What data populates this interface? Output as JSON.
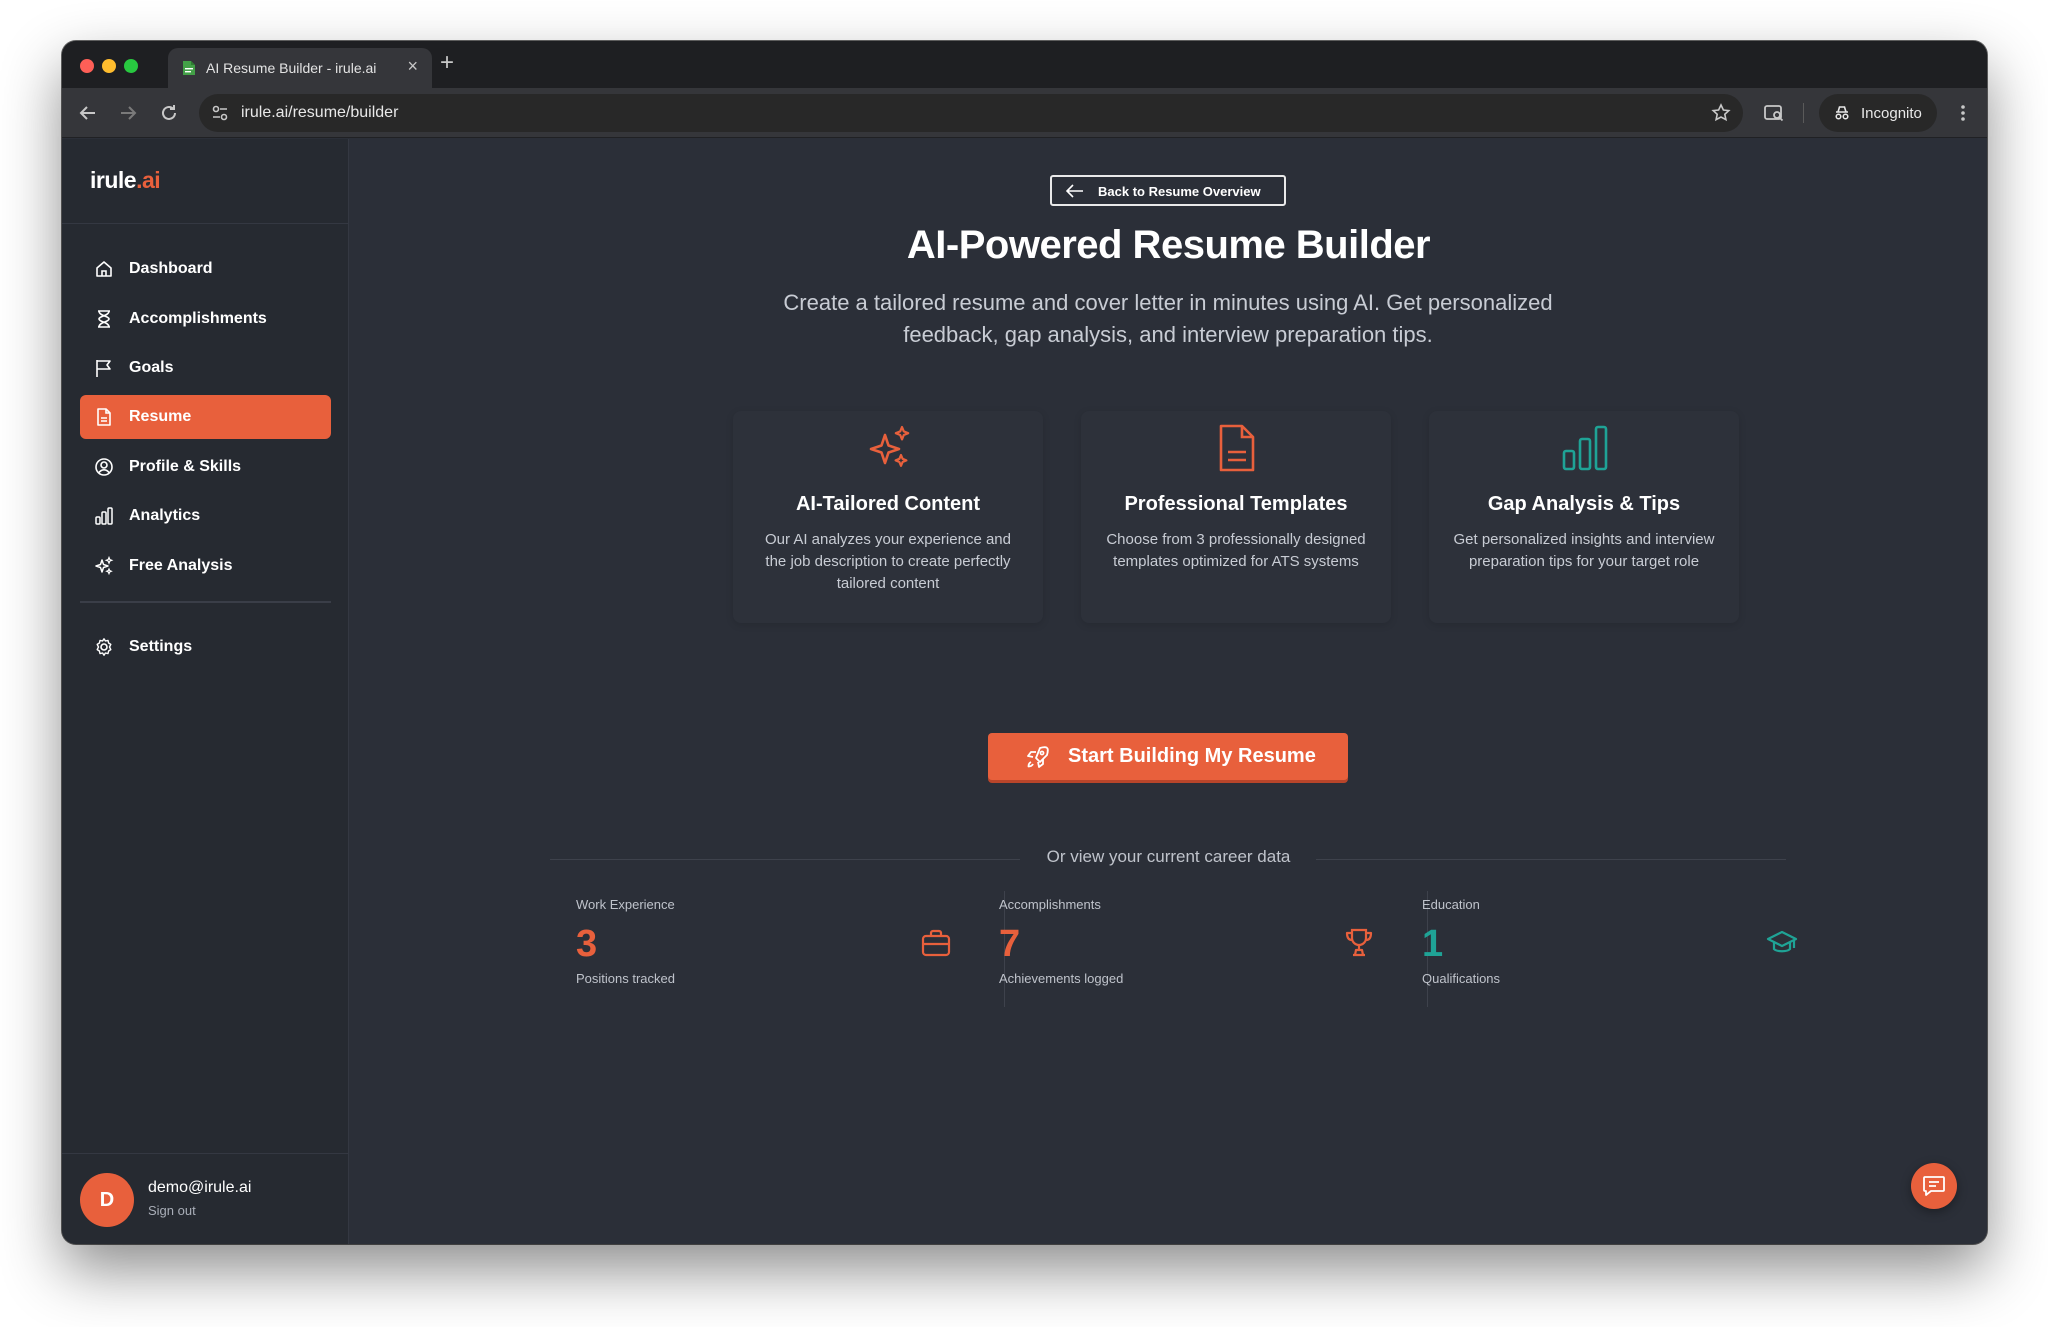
{
  "browser": {
    "tab_title": "AI Resume Builder - irule.ai",
    "url": "irule.ai/resume/builder",
    "incognito_label": "Incognito"
  },
  "brand": {
    "logo_main": "irule",
    "logo_accent": ".ai",
    "accent_color": "#e8603c",
    "teal_color": "#1fa396"
  },
  "sidebar": {
    "items": [
      {
        "label": "Dashboard",
        "icon": "home-icon"
      },
      {
        "label": "Accomplishments",
        "icon": "hourglass-icon"
      },
      {
        "label": "Goals",
        "icon": "flag-icon"
      },
      {
        "label": "Resume",
        "icon": "document-icon",
        "active": true
      },
      {
        "label": "Profile & Skills",
        "icon": "user-circle-icon"
      },
      {
        "label": "Analytics",
        "icon": "bar-chart-icon"
      },
      {
        "label": "Free Analysis",
        "icon": "sparkles-icon"
      }
    ],
    "settings_label": "Settings",
    "user": {
      "initial": "D",
      "email": "demo@irule.ai",
      "signout": "Sign out"
    }
  },
  "main": {
    "back_label": "Back to Resume Overview",
    "title": "AI-Powered Resume Builder",
    "subtitle": "Create a tailored resume and cover letter in minutes using AI. Get personalized feedback, gap analysis, and interview preparation tips.",
    "features": [
      {
        "title": "AI-Tailored Content",
        "desc": "Our AI analyzes your experience and the job description to create perfectly tailored content",
        "icon": "sparkles-icon"
      },
      {
        "title": "Professional Templates",
        "desc": "Choose from 3 professionally designed templates optimized for ATS systems",
        "icon": "document-icon"
      },
      {
        "title": "Gap Analysis & Tips",
        "desc": "Get personalized insights and interview preparation tips for your target role",
        "icon": "bar-chart-icon"
      }
    ],
    "cta_label": "Start Building My Resume",
    "divider_text": "Or view your current career data",
    "stats": [
      {
        "label": "Work Experience",
        "value": "3",
        "caption": "Positions tracked",
        "icon": "briefcase-icon",
        "color": "#e8603c"
      },
      {
        "label": "Accomplishments",
        "value": "7",
        "caption": "Achievements logged",
        "icon": "trophy-icon",
        "color": "#e8603c"
      },
      {
        "label": "Education",
        "value": "1",
        "caption": "Qualifications",
        "icon": "graduation-cap-icon",
        "color": "#1fa396"
      }
    ]
  }
}
